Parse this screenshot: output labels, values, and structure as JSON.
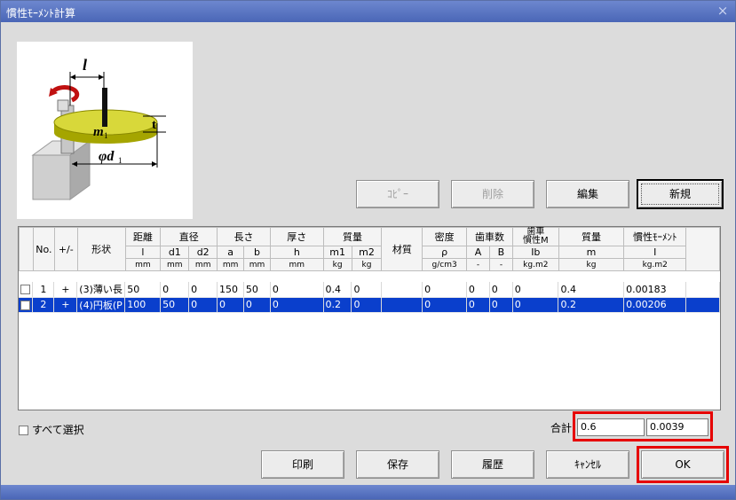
{
  "window": {
    "title": "慣性ﾓｰﾒﾝﾄ計算",
    "close_glyph": "×"
  },
  "diagram": {
    "labels": {
      "l": "l",
      "m1": "m",
      "m1_sub": "1",
      "t": "t",
      "d1": "φd",
      "d1_sub": "1"
    }
  },
  "top_buttons": {
    "copy": "ｺﾋﾟｰ",
    "delete": "削除",
    "edit": "編集",
    "new": "新規"
  },
  "table": {
    "headers": {
      "no": "No.",
      "sign": "+/-",
      "shape": "形状",
      "distance": "距離",
      "diameter": "直径",
      "length": "長さ",
      "thickness": "厚さ",
      "mass_pair": "質量",
      "material": "材質",
      "density": "密度",
      "teeth": "歯車数",
      "gear_inertia_1": "歯車",
      "gear_inertia_2": "慣性M",
      "mass": "質量",
      "inertia": "慣性ﾓｰﾒﾝﾄ"
    },
    "subheaders": {
      "distance": "l",
      "d1": "d1",
      "d2": "d2",
      "a": "a",
      "b": "b",
      "h": "h",
      "m1": "m1",
      "m2": "m2",
      "rho": "ρ",
      "A": "A",
      "B": "B",
      "Ib": "Ib",
      "m": "m",
      "I": "I"
    },
    "units": {
      "distance": "mm",
      "d1": "mm",
      "d2": "mm",
      "a": "mm",
      "b": "mm",
      "h": "mm",
      "m1": "kg",
      "m2": "kg",
      "rho": "g/cm3",
      "A": "-",
      "B": "-",
      "Ib": "kg.m2",
      "m": "kg",
      "I": "kg.m2"
    },
    "rows": [
      {
        "no": "1",
        "sign": "+",
        "shape": "(3)薄い長",
        "distance": "50",
        "d1": "0",
        "d2": "0",
        "a": "150",
        "b": "50",
        "h": "0",
        "m1": "0.4",
        "m2": "0",
        "material": "",
        "rho": "0",
        "A": "0",
        "B": "0",
        "Ib": "0",
        "m": "0.4",
        "I": "0.00183",
        "selected": false
      },
      {
        "no": "2",
        "sign": "+",
        "shape": "(4)円板(P",
        "distance": "100",
        "d1": "50",
        "d2": "0",
        "a": "0",
        "b": "0",
        "h": "0",
        "m1": "0.2",
        "m2": "0",
        "material": "",
        "rho": "0",
        "A": "0",
        "B": "0",
        "Ib": "0",
        "m": "0.2",
        "I": "0.00206",
        "selected": true
      }
    ]
  },
  "select_all_label": "すべて選択",
  "totals": {
    "label": "合計",
    "mass": "0.6",
    "inertia": "0.0039"
  },
  "bottom_buttons": {
    "print": "印刷",
    "save": "保存",
    "history": "履歴",
    "cancel": "ｷｬﾝｾﾙ",
    "ok": "OK"
  },
  "colors": {
    "selection": "#0a3fcc",
    "highlight": "#e60000",
    "titlebar": "#4a66b7",
    "yellow_disc": "#c8c800"
  }
}
